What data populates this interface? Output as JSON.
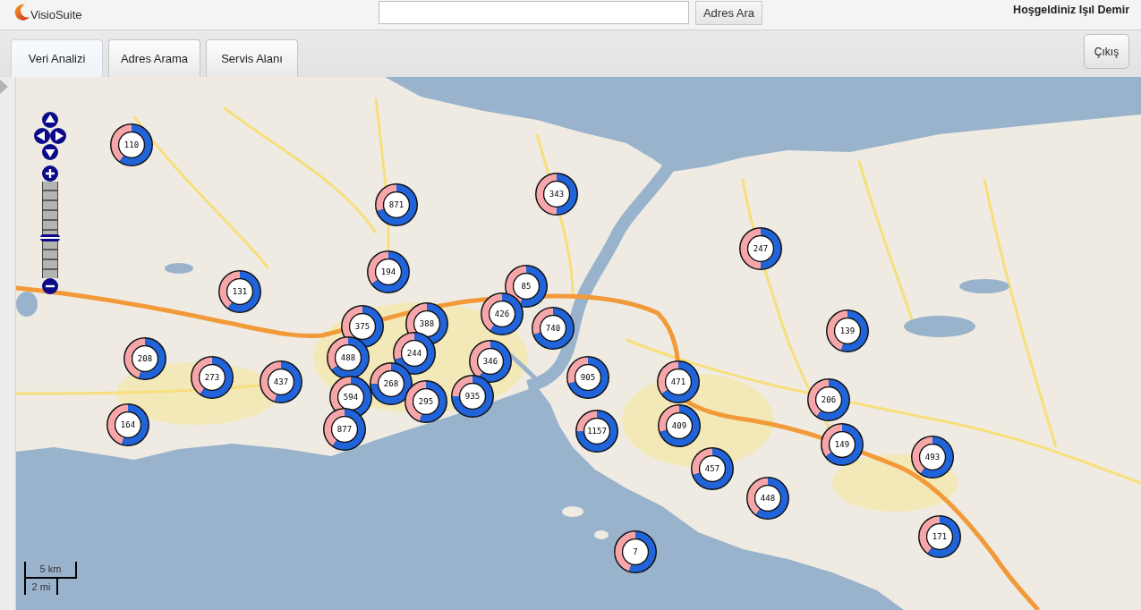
{
  "header": {
    "logo": "VisioSuite",
    "search_button": "Adres Ara",
    "welcome": "Hoşgeldiniz Işıl Demir"
  },
  "tabs": [
    {
      "label": "Veri Analizi",
      "selected": true
    },
    {
      "label": "Adres Arama",
      "selected": false
    },
    {
      "label": "Servis Alanı",
      "selected": false
    }
  ],
  "logout_button": "Çıkış",
  "map": {
    "zoom_slider": {
      "level": 0.41
    },
    "scale": {
      "metric": "5 km",
      "imperial": "2 mi"
    },
    "markers": [
      {
        "count": "110"
      },
      {
        "count": "343"
      },
      {
        "count": "871"
      },
      {
        "count": "247"
      },
      {
        "count": "194"
      },
      {
        "count": "131"
      },
      {
        "count": "85"
      },
      {
        "count": "426"
      },
      {
        "count": "375"
      },
      {
        "count": "388"
      },
      {
        "count": "740"
      },
      {
        "count": "139"
      },
      {
        "count": "208"
      },
      {
        "count": "488"
      },
      {
        "count": "244"
      },
      {
        "count": "346"
      },
      {
        "count": "273"
      },
      {
        "count": "437"
      },
      {
        "count": "268"
      },
      {
        "count": "905"
      },
      {
        "count": "471"
      },
      {
        "count": "594"
      },
      {
        "count": "295"
      },
      {
        "count": "935"
      },
      {
        "count": "206"
      },
      {
        "count": "164"
      },
      {
        "count": "877"
      },
      {
        "count": "1157"
      },
      {
        "count": "409"
      },
      {
        "count": "149"
      },
      {
        "count": "493"
      },
      {
        "count": "457"
      },
      {
        "count": "448"
      },
      {
        "count": "171"
      },
      {
        "count": "7"
      }
    ]
  }
}
